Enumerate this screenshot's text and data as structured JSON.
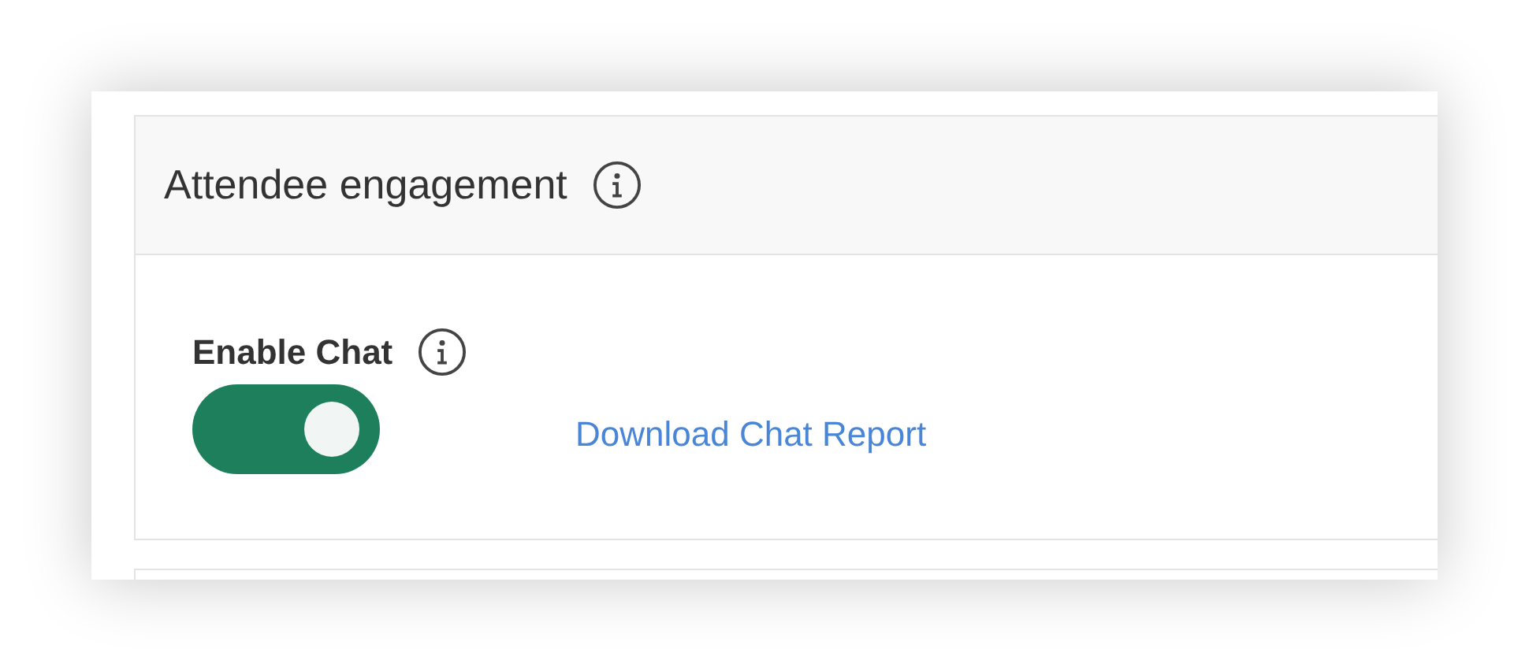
{
  "section": {
    "title": "Attendee engagement"
  },
  "chat": {
    "label": "Enable Chat",
    "on": true,
    "link": "Download Chat Report"
  }
}
